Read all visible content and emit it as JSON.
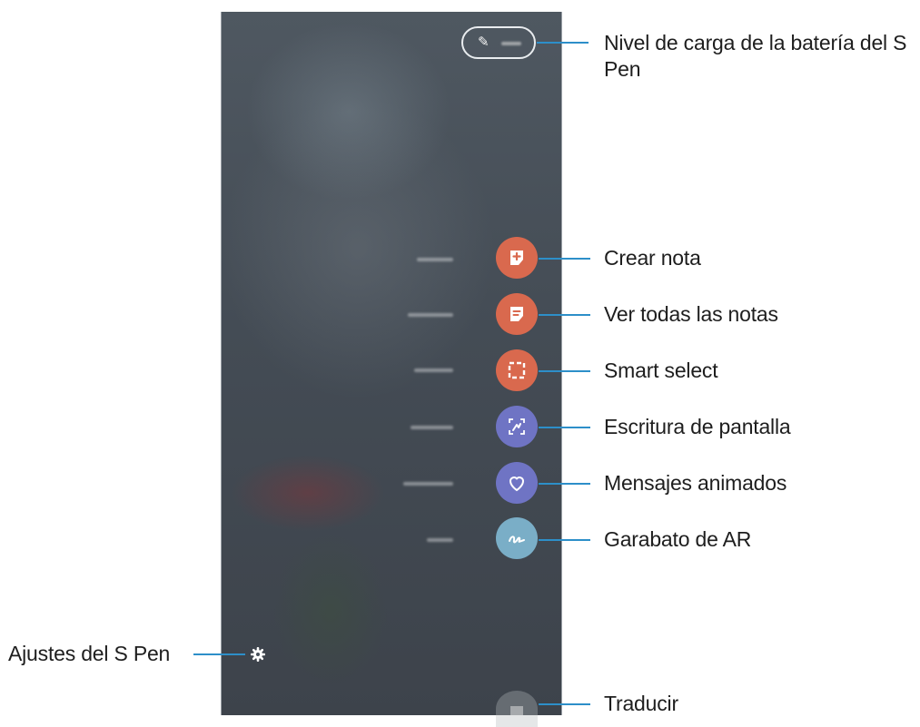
{
  "callouts": {
    "battery": "Nivel de carga de la batería del S Pen",
    "create_note": "Crear nota",
    "view_all_notes": "Ver todas las notas",
    "smart_select": "Smart select",
    "screen_write": "Escritura de pantalla",
    "live_messages": "Mensajes animados",
    "ar_doodle": "Garabato de AR",
    "translate": "Traducir",
    "settings": "Ajustes del S Pen"
  },
  "colors": {
    "accent_line": "#2d8fc9",
    "create_note_btn": "#d9694e",
    "view_notes_btn": "#d9694e",
    "smart_select_btn": "#d9694e",
    "screen_write_btn": "#6f74c4",
    "live_messages_btn": "#6f74c4",
    "ar_doodle_btn": "#7aaec7"
  },
  "icons": {
    "battery": "pen-icon",
    "create_note": "note-plus-icon",
    "view_all_notes": "notes-list-icon",
    "smart_select": "dashed-select-icon",
    "screen_write": "screen-write-icon",
    "live_messages": "heart-icon",
    "ar_doodle": "doodle-icon",
    "translate": "translate-icon",
    "settings": "gear-icon"
  }
}
